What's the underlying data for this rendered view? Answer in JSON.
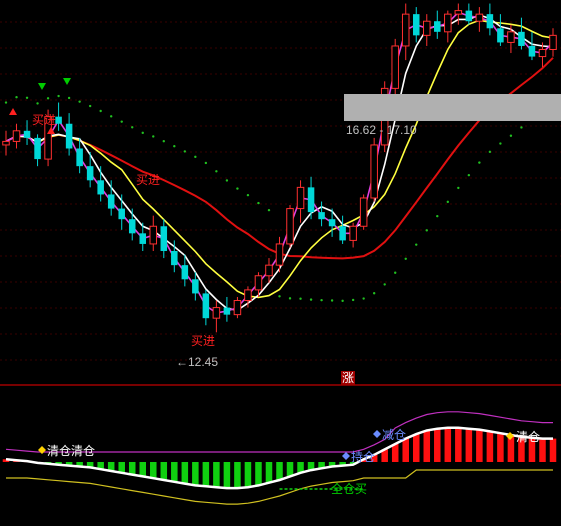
{
  "chart_data": {
    "type": "candlestick",
    "upper_panel": {
      "price_high_label": "16.62 - 17.10",
      "price_low_label": "←12.45",
      "buy_labels": [
        "买进",
        "买进",
        "买进"
      ],
      "candles": [
        [
          15.1,
          15.3,
          14.95,
          15.15
        ],
        [
          15.15,
          15.4,
          15.05,
          15.3
        ],
        [
          15.3,
          15.45,
          15.1,
          15.2
        ],
        [
          15.2,
          15.25,
          14.8,
          14.9
        ],
        [
          14.9,
          15.6,
          14.8,
          15.5
        ],
        [
          15.5,
          15.7,
          15.3,
          15.4
        ],
        [
          15.4,
          15.55,
          14.95,
          15.05
        ],
        [
          15.05,
          15.2,
          14.7,
          14.8
        ],
        [
          14.8,
          15.0,
          14.5,
          14.6
        ],
        [
          14.6,
          14.8,
          14.3,
          14.4
        ],
        [
          14.4,
          14.6,
          14.1,
          14.2
        ],
        [
          14.2,
          14.4,
          13.9,
          14.05
        ],
        [
          14.05,
          14.2,
          13.75,
          13.85
        ],
        [
          13.85,
          14.0,
          13.6,
          13.7
        ],
        [
          13.7,
          14.1,
          13.6,
          13.95
        ],
        [
          13.95,
          14.05,
          13.5,
          13.6
        ],
        [
          13.6,
          13.75,
          13.3,
          13.4
        ],
        [
          13.4,
          13.55,
          13.1,
          13.2
        ],
        [
          13.2,
          13.3,
          12.9,
          13.0
        ],
        [
          13.0,
          13.05,
          12.55,
          12.65
        ],
        [
          12.65,
          12.9,
          12.45,
          12.8
        ],
        [
          12.8,
          12.95,
          12.6,
          12.7
        ],
        [
          12.7,
          12.95,
          12.65,
          12.9
        ],
        [
          12.9,
          13.1,
          12.8,
          13.05
        ],
        [
          13.05,
          13.3,
          12.95,
          13.25
        ],
        [
          13.25,
          13.5,
          13.15,
          13.4
        ],
        [
          13.4,
          13.8,
          13.3,
          13.7
        ],
        [
          13.7,
          14.25,
          13.65,
          14.2
        ],
        [
          14.2,
          14.6,
          14.0,
          14.5
        ],
        [
          14.5,
          14.65,
          14.05,
          14.15
        ],
        [
          14.15,
          14.3,
          13.95,
          14.05
        ],
        [
          14.05,
          14.2,
          13.8,
          13.95
        ],
        [
          13.95,
          14.1,
          13.7,
          13.75
        ],
        [
          13.75,
          14.0,
          13.65,
          13.95
        ],
        [
          13.95,
          14.4,
          13.9,
          14.35
        ],
        [
          14.35,
          15.2,
          14.3,
          15.1
        ],
        [
          15.1,
          16.0,
          15.0,
          15.9
        ],
        [
          15.9,
          16.6,
          15.8,
          16.5
        ],
        [
          16.5,
          17.1,
          16.3,
          16.95
        ],
        [
          16.95,
          17.05,
          16.55,
          16.65
        ],
        [
          16.65,
          16.95,
          16.5,
          16.85
        ],
        [
          16.85,
          17.0,
          16.6,
          16.7
        ],
        [
          16.7,
          17.0,
          16.55,
          16.95
        ],
        [
          16.95,
          17.1,
          16.8,
          17.0
        ],
        [
          17.0,
          17.1,
          16.8,
          16.85
        ],
        [
          16.85,
          17.05,
          16.7,
          16.95
        ],
        [
          16.95,
          17.1,
          16.65,
          16.75
        ],
        [
          16.75,
          16.95,
          16.5,
          16.55
        ],
        [
          16.55,
          16.8,
          16.4,
          16.7
        ],
        [
          16.7,
          16.9,
          16.45,
          16.5
        ],
        [
          16.5,
          16.7,
          16.3,
          16.35
        ],
        [
          16.35,
          16.55,
          16.2,
          16.45
        ],
        [
          16.45,
          16.75,
          16.35,
          16.65
        ]
      ],
      "ylim": [
        12.2,
        17.15
      ]
    },
    "divider_label": "涨",
    "lower_panel": {
      "signal_labels": [
        "清仓",
        "清仓",
        "减仓",
        "持仓",
        "清仓",
        "全仓买"
      ],
      "histogram": [
        0.3,
        0.2,
        0.1,
        -0.1,
        -0.2,
        -0.3,
        -0.4,
        -0.5,
        -0.6,
        -0.8,
        -1.0,
        -1.2,
        -1.4,
        -1.6,
        -1.8,
        -2.0,
        -2.2,
        -2.4,
        -2.6,
        -2.7,
        -2.8,
        -2.9,
        -2.9,
        -2.8,
        -2.6,
        -2.3,
        -2.0,
        -1.6,
        -1.2,
        -0.9,
        -0.7,
        -0.5,
        -0.4,
        -0.3,
        0.3,
        0.8,
        1.4,
        2.0,
        2.6,
        3.1,
        3.5,
        3.7,
        3.8,
        3.8,
        3.7,
        3.6,
        3.4,
        3.2,
        3.0,
        2.8,
        2.7,
        2.6,
        2.6
      ]
    }
  }
}
